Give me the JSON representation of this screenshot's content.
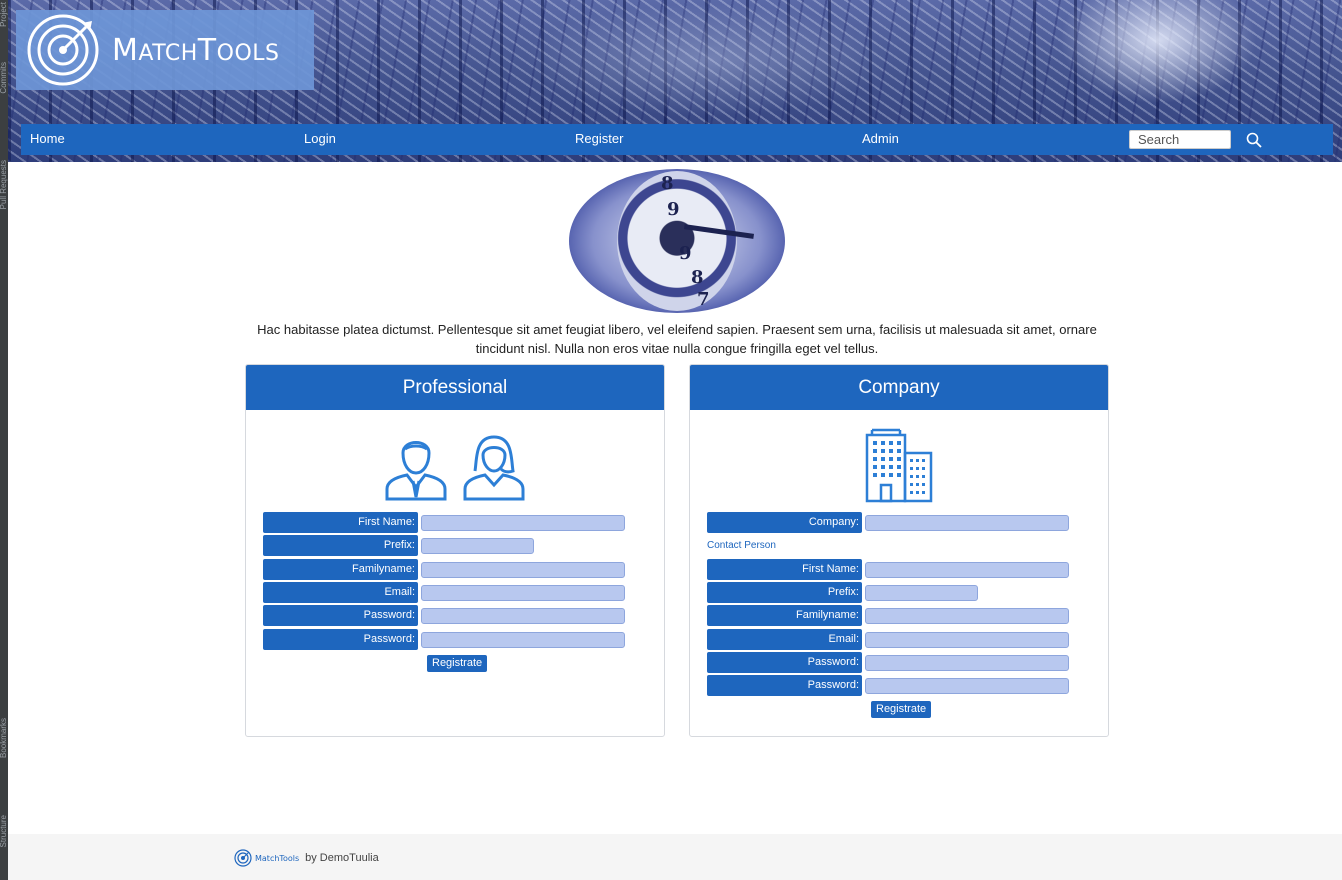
{
  "ide": {
    "strip_labels": [
      "Project",
      "Commits",
      "Pull Requests",
      "Bookmarks",
      "Structure"
    ]
  },
  "header": {
    "logo": {
      "text_big1": "M",
      "text_small1": "ATCH",
      "text_big2": "T",
      "text_small2": "OOLS",
      "icon": "target-icon"
    },
    "nav": [
      {
        "label": "Home"
      },
      {
        "label": "Login"
      },
      {
        "label": "Register"
      },
      {
        "label": "Admin"
      }
    ],
    "search": {
      "placeholder": "Search",
      "icon": "search-icon"
    }
  },
  "hero": {
    "numbers": [
      "8",
      "9",
      "9",
      "8",
      "7"
    ]
  },
  "intro": "Hac habitasse platea dictumst. Pellentesque sit amet feugiat libero, vel eleifend sapien. Praesent sem urna, facilisis ut malesuada sit amet, ornare tincidunt nisl. Nulla non eros vitae nulla congue fringilla eget vel tellus.",
  "professional": {
    "title": "Professional",
    "icons": [
      "male-user-icon",
      "female-user-icon"
    ],
    "fields": [
      {
        "label": "First Name:",
        "value": ""
      },
      {
        "label": "Prefix:",
        "value": ""
      },
      {
        "label": "Familyname:",
        "value": ""
      },
      {
        "label": "Email:",
        "value": ""
      },
      {
        "label": "Password:",
        "value": ""
      },
      {
        "label": "Password:",
        "value": ""
      }
    ],
    "submit": "Registrate"
  },
  "company": {
    "title": "Company",
    "icon": "building-icon",
    "company_label": "Company:",
    "contact_heading": "Contact Person",
    "fields": [
      {
        "label": "First Name:",
        "value": ""
      },
      {
        "label": "Prefix:",
        "value": ""
      },
      {
        "label": "Familyname:",
        "value": ""
      },
      {
        "label": "Email:",
        "value": ""
      },
      {
        "label": "Password:",
        "value": ""
      },
      {
        "label": "Password:",
        "value": ""
      }
    ],
    "submit": "Registrate"
  },
  "footer": {
    "logo_text": "MatchTools",
    "by_text": "by DemoTuulia"
  },
  "colors": {
    "primary": "#1e66be",
    "input_fill": "#b8c8ef",
    "footer_bg": "#f5f5f5"
  }
}
